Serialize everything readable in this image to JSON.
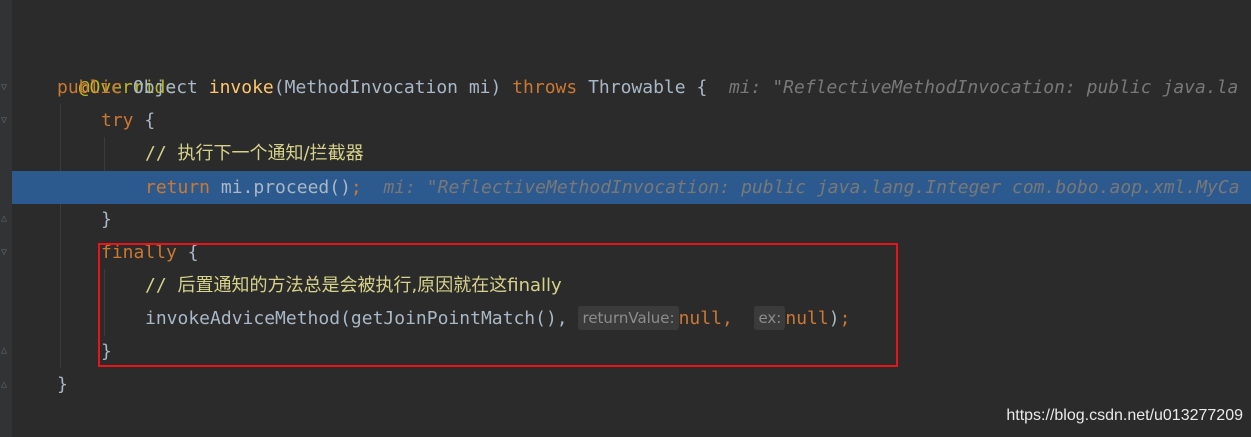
{
  "editor": {
    "line1": {
      "annotation": "@Override"
    },
    "line2": {
      "kw_public": "public",
      "type_object": "Object",
      "method": "invoke",
      "params": "(MethodInvocation mi)",
      "kw_throws": "throws",
      "type_throwable": "Throwable",
      "brace": "{",
      "hint": "mi: \"ReflectiveMethodInvocation: public java.la"
    },
    "line3": {
      "kw_try": "try",
      "brace": "{"
    },
    "line4": {
      "slashes": "//",
      "comment": "执行下一个通知/拦截器"
    },
    "line5": {
      "kw_return": "return",
      "expr": "mi.proceed()",
      "semicolon": ";",
      "hint": "mi: \"ReflectiveMethodInvocation: public java.lang.Integer com.bobo.aop.xml.MyCa"
    },
    "line6": {
      "brace": "}"
    },
    "line7": {
      "kw_finally": "finally",
      "brace": "{"
    },
    "line8": {
      "slashes": "//",
      "comment": "后置通知的方法总是会被执行,原因就在这finally"
    },
    "line9": {
      "call": "invokeAdviceMethod(getJoinPointMatch(),",
      "hint_return_value": "returnValue:",
      "null1": "null,",
      "hint_ex": "ex:",
      "null2": "null",
      "close": ")",
      "semicolon": ";"
    },
    "line10": {
      "brace": "}"
    },
    "line11": {
      "brace": "}"
    }
  },
  "watermark": "https://blog.csdn.net/u013277209"
}
